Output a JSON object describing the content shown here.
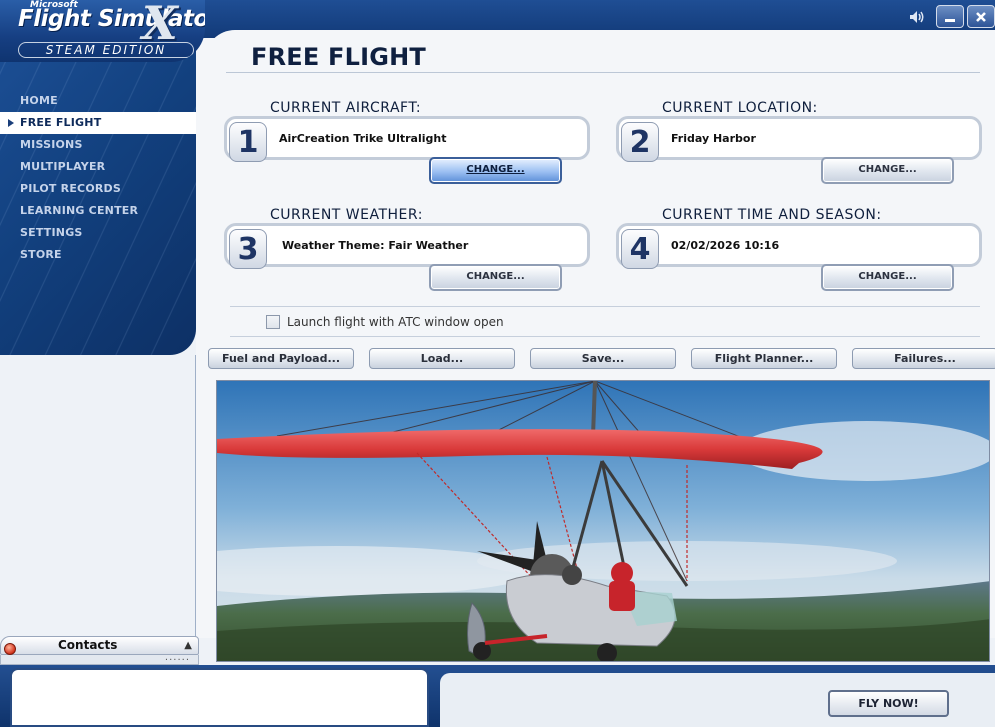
{
  "app": {
    "brand": "Microsoft",
    "title": "Flight Simulator",
    "title_mark": "X",
    "edition": "STEAM EDITION"
  },
  "nav": {
    "items": [
      {
        "label": "HOME",
        "active": false
      },
      {
        "label": "FREE FLIGHT",
        "active": true
      },
      {
        "label": "MISSIONS",
        "active": false
      },
      {
        "label": "MULTIPLAYER",
        "active": false
      },
      {
        "label": "PILOT RECORDS",
        "active": false
      },
      {
        "label": "LEARNING CENTER",
        "active": false
      },
      {
        "label": "SETTINGS",
        "active": false
      },
      {
        "label": "STORE",
        "active": false
      }
    ]
  },
  "page": {
    "title": "FREE FLIGHT"
  },
  "sections": {
    "aircraft": {
      "number": "1",
      "label": "CURRENT AIRCRAFT:",
      "value": "AirCreation Trike Ultralight",
      "change_label": "CHANGE..."
    },
    "location": {
      "number": "2",
      "label": "CURRENT LOCATION:",
      "value": "Friday Harbor",
      "change_label": "CHANGE..."
    },
    "weather": {
      "number": "3",
      "label": "CURRENT WEATHER:",
      "value": "Weather Theme: Fair Weather",
      "change_label": "CHANGE..."
    },
    "time": {
      "number": "4",
      "label": "CURRENT TIME AND SEASON:",
      "value": "02/02/2026 10:16",
      "change_label": "CHANGE..."
    }
  },
  "atc": {
    "label": "Launch flight with ATC window open",
    "checked": false
  },
  "actions": {
    "fuel": "Fuel and Payload...",
    "load": "Load...",
    "save": "Save...",
    "planner": "Flight Planner...",
    "failures": "Failures..."
  },
  "contacts": {
    "label": "Contacts",
    "status_color": "#d2311a",
    "dots": "......"
  },
  "fly_now": "FLY NOW!",
  "colors": {
    "brand_blue": "#163f82",
    "focused_button": "#9cc0f2",
    "wing_red": "#d93a3a"
  }
}
